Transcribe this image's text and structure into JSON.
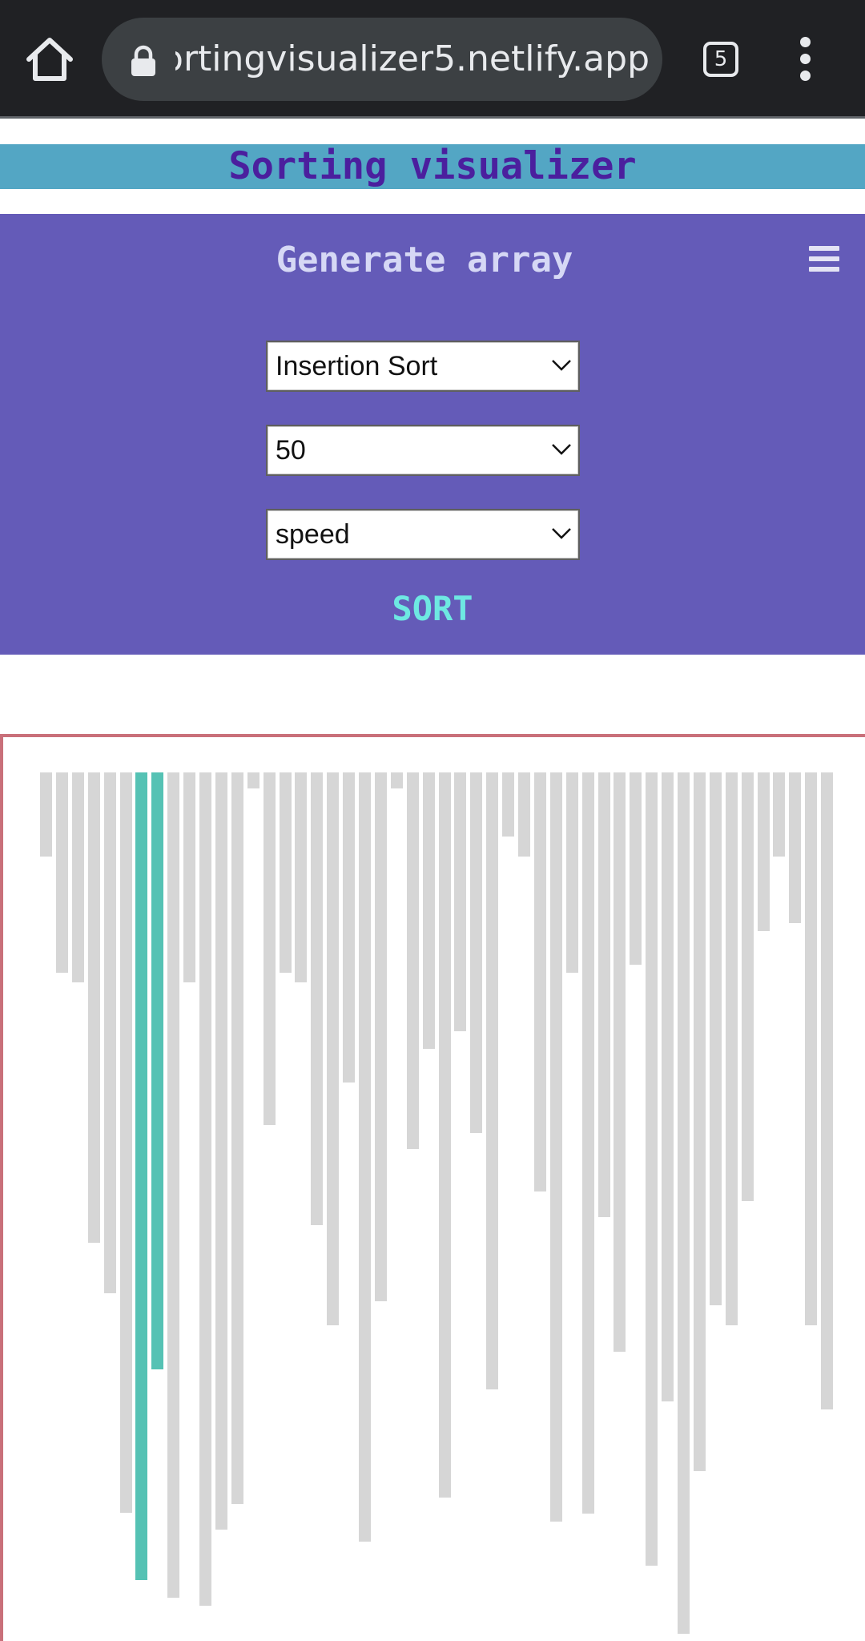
{
  "browser": {
    "url": "sortingvisualizer5.netlify.app",
    "tab_count": "5",
    "icons": [
      "home-icon",
      "lock-icon",
      "tab-switcher-icon",
      "overflow-menu-icon"
    ]
  },
  "header": {
    "title": "Sorting visualizer"
  },
  "controls": {
    "generate_label": "Generate array",
    "algorithm": {
      "selected": "Insertion Sort"
    },
    "array_size": {
      "selected": "50"
    },
    "speed": {
      "selected": "speed"
    },
    "sort_label": "SORT",
    "menu_icon": "hamburger-icon"
  },
  "colors": {
    "browser_bar": "#202124",
    "header_bg": "#53a6c4",
    "header_text": "#4b1f9e",
    "controls_bg": "#645bb8",
    "generate_text": "#d6d8f5",
    "sort_text": "#6ee8e2",
    "bar_default": "#d6d6d6",
    "bar_active": "#55c2b4",
    "area_border": "#c9707a"
  },
  "chart_data": {
    "type": "bar",
    "state": "insertion sort in progress — two highlighted bars being compared",
    "values": [
      105,
      250,
      262,
      587,
      650,
      924,
      1008,
      745,
      1030,
      262,
      1040,
      945,
      913,
      20,
      440,
      250,
      262,
      565,
      690,
      387,
      960,
      660,
      20,
      470,
      345,
      905,
      323,
      450,
      770,
      80,
      105,
      523,
      935,
      250,
      925,
      555,
      723,
      240,
      990,
      785,
      1075,
      872,
      665,
      690,
      535,
      198,
      105,
      188,
      690,
      795
    ],
    "highlighted": [
      6,
      7
    ]
  }
}
